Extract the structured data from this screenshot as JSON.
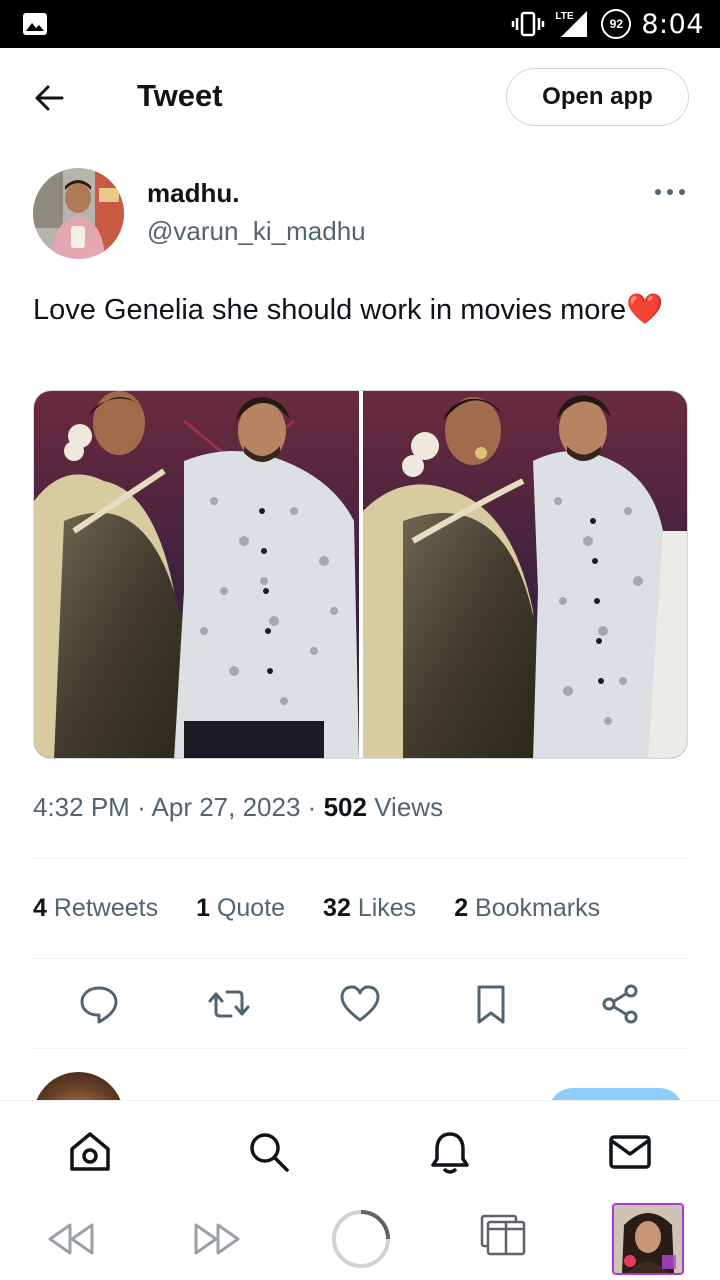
{
  "status_bar": {
    "network": "LTE",
    "battery": "92",
    "time": "8:04"
  },
  "header": {
    "title": "Tweet",
    "open_app_label": "Open app"
  },
  "tweet": {
    "author_name": "madhu.",
    "author_handle": "@varun_ki_madhu",
    "text": "Love Genelia she should work in movies more",
    "emoji": "❤️",
    "time": "4:32 PM",
    "separator": "·",
    "date": "Apr 27, 2023",
    "views_count": "502",
    "views_label": "Views",
    "stats": [
      {
        "count": "4",
        "label": "Retweets"
      },
      {
        "count": "1",
        "label": "Quote"
      },
      {
        "count": "32",
        "label": "Likes"
      },
      {
        "count": "2",
        "label": "Bookmarks"
      }
    ]
  },
  "icons": {
    "back": "arrow-left-icon",
    "more": "more-horizontal-icon",
    "reply": "reply-icon",
    "retweet": "retweet-icon",
    "like": "heart-icon",
    "bookmark": "bookmark-icon",
    "share": "share-icon",
    "tab_home": "home-icon",
    "tab_search": "search-icon",
    "tab_notifications": "bell-icon",
    "tab_messages": "mail-icon",
    "nav_back": "rewind-icon",
    "nav_forward": "fast-forward-icon",
    "nav_loading": "loading-spinner-icon",
    "nav_tabs": "tabs-icon"
  },
  "colors": {
    "text_primary": "#0f1419",
    "text_secondary": "#536471",
    "border": "#cfd9de",
    "follow_button": "#8ecdf8",
    "heart_emoji": "#e0212e",
    "tab_thumb_border": "#a23ad3"
  }
}
